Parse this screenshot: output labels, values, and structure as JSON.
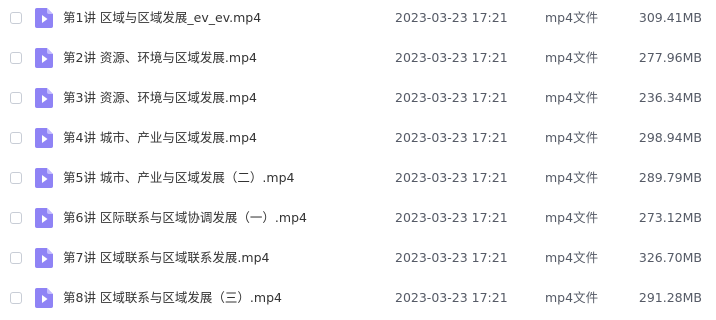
{
  "files": [
    {
      "name": "第1讲 区域与区域发展_ev_ev.mp4",
      "date": "2023-03-23 17:21",
      "type": "mp4文件",
      "size": "309.41MB",
      "icon": "video-file-icon"
    },
    {
      "name": "第2讲 资源、环境与区域发展.mp4",
      "date": "2023-03-23 17:21",
      "type": "mp4文件",
      "size": "277.96MB",
      "icon": "video-file-icon"
    },
    {
      "name": "第3讲 资源、环境与区域发展.mp4",
      "date": "2023-03-23 17:21",
      "type": "mp4文件",
      "size": "236.34MB",
      "icon": "video-file-icon"
    },
    {
      "name": "第4讲 城市、产业与区域发展.mp4",
      "date": "2023-03-23 17:21",
      "type": "mp4文件",
      "size": "298.94MB",
      "icon": "video-file-icon"
    },
    {
      "name": "第5讲 城市、产业与区域发展（二）.mp4",
      "date": "2023-03-23 17:21",
      "type": "mp4文件",
      "size": "289.79MB",
      "icon": "video-file-icon"
    },
    {
      "name": "第6讲 区际联系与区域协调发展（一）.mp4",
      "date": "2023-03-23 17:21",
      "type": "mp4文件",
      "size": "273.12MB",
      "icon": "video-file-icon"
    },
    {
      "name": "第7讲 区域联系与区域联系发展.mp4",
      "date": "2023-03-23 17:21",
      "type": "mp4文件",
      "size": "326.70MB",
      "icon": "video-file-icon"
    },
    {
      "name": "第8讲 区域联系与区域发展（三）.mp4",
      "date": "2023-03-23 17:21",
      "type": "mp4文件",
      "size": "291.28MB",
      "icon": "video-file-icon"
    }
  ],
  "colors": {
    "icon_fill": "#8f83f5",
    "icon_fold": "#c4bcff",
    "icon_play": "#ffffff",
    "checkbox_border": "#c8cdd6"
  }
}
